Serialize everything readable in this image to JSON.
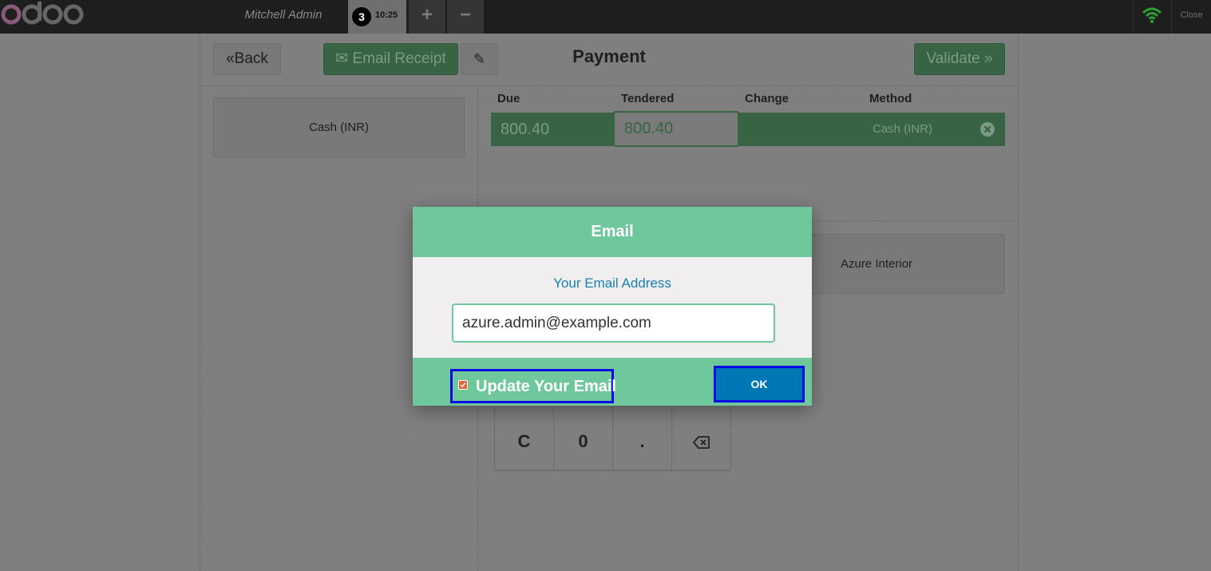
{
  "topbar": {
    "cashier": "Mitchell Admin",
    "order_number": "3",
    "order_time": "10:25",
    "add_label": "+",
    "remove_label": "−",
    "close_label": "Close"
  },
  "payment": {
    "back_label": "Back",
    "email_receipt_label": "Email Receipt",
    "title": "Payment",
    "validate_label": "Validate",
    "payment_method_button": "Cash (INR)",
    "columns": [
      "Due",
      "Tendered",
      "Change",
      "Method"
    ],
    "line": {
      "due": "800.40",
      "tendered": "800.40",
      "change": "",
      "method": "Cash (INR)"
    },
    "customer_button": "Azure Interior",
    "numpad_keys": [
      "C",
      "0",
      "."
    ]
  },
  "modal": {
    "title": "Email",
    "label": "Your Email Address",
    "email_value": "azure.admin@example.com",
    "update_label": "Update Your Email",
    "update_checked": true,
    "ok_label": "OK"
  },
  "colors": {
    "odoo_brand": "#875a7b",
    "modal_green": "#6ec89b",
    "ok_blue": "#0077b5",
    "highlight_border": "#0a0ae6",
    "checkbox": "#e8603c"
  }
}
